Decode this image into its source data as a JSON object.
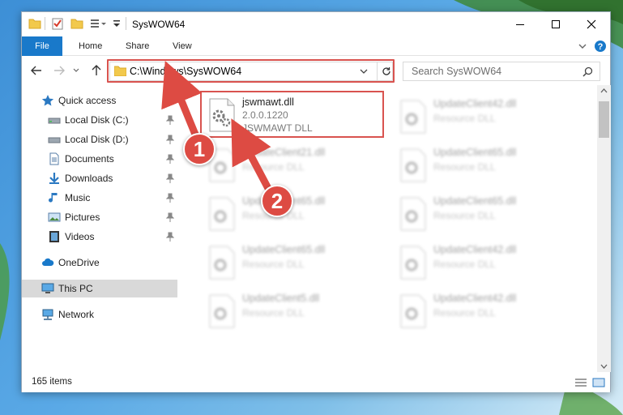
{
  "window": {
    "title": "SysWOW64",
    "minimize_icon": "minimize-icon",
    "maximize_icon": "maximize-icon",
    "close_icon": "close-icon"
  },
  "ribbon": {
    "tabs": [
      {
        "label": "File"
      },
      {
        "label": "Home"
      },
      {
        "label": "Share"
      },
      {
        "label": "View"
      }
    ]
  },
  "address": {
    "path": "C:\\Windows\\SysWOW64",
    "search_placeholder": "Search SysWOW64"
  },
  "sidebar": {
    "items": [
      {
        "label": "Quick access",
        "icon": "star-icon"
      },
      {
        "label": "Local Disk (C:)",
        "icon": "drive-icon",
        "pinned": true
      },
      {
        "label": "Local Disk (D:)",
        "icon": "drive-icon",
        "pinned": true
      },
      {
        "label": "Documents",
        "icon": "documents-icon",
        "pinned": true
      },
      {
        "label": "Downloads",
        "icon": "download-icon",
        "pinned": true
      },
      {
        "label": "Music",
        "icon": "music-icon",
        "pinned": true
      },
      {
        "label": "Pictures",
        "icon": "pictures-icon",
        "pinned": true
      },
      {
        "label": "Videos",
        "icon": "video-icon",
        "pinned": true
      },
      {
        "label": "OneDrive",
        "icon": "cloud-icon"
      },
      {
        "label": "This PC",
        "icon": "computer-icon",
        "selected": true
      },
      {
        "label": "Network",
        "icon": "network-icon"
      }
    ]
  },
  "files": {
    "highlighted": {
      "name": "jswmawt.dll",
      "version": "2.0.0.1220",
      "description": "JSWMAWT DLL"
    },
    "others": [
      {
        "name": "UpdateClient42.dll",
        "description": "Resource DLL"
      },
      {
        "name": "UpdateClient21.dll",
        "description": "Resource DLL"
      },
      {
        "name": "UpdateClient65.dll",
        "description": "Resource DLL"
      },
      {
        "name": "UpdateClient65.dll",
        "description": "Resource DLL"
      },
      {
        "name": "UpdateClient65.dll",
        "description": "Resource DLL"
      },
      {
        "name": "UpdateClient65.dll",
        "description": "Resource DLL"
      },
      {
        "name": "UpdateClient42.dll",
        "description": "Resource DLL"
      },
      {
        "name": "UpdateClient5.dll",
        "description": "Resource DLL"
      },
      {
        "name": "UpdateClient42.dll",
        "description": "Resource DLL"
      }
    ]
  },
  "status": {
    "item_count": "165 items"
  },
  "annotations": {
    "step1": "1",
    "step2": "2",
    "color": "#dd4b43"
  }
}
